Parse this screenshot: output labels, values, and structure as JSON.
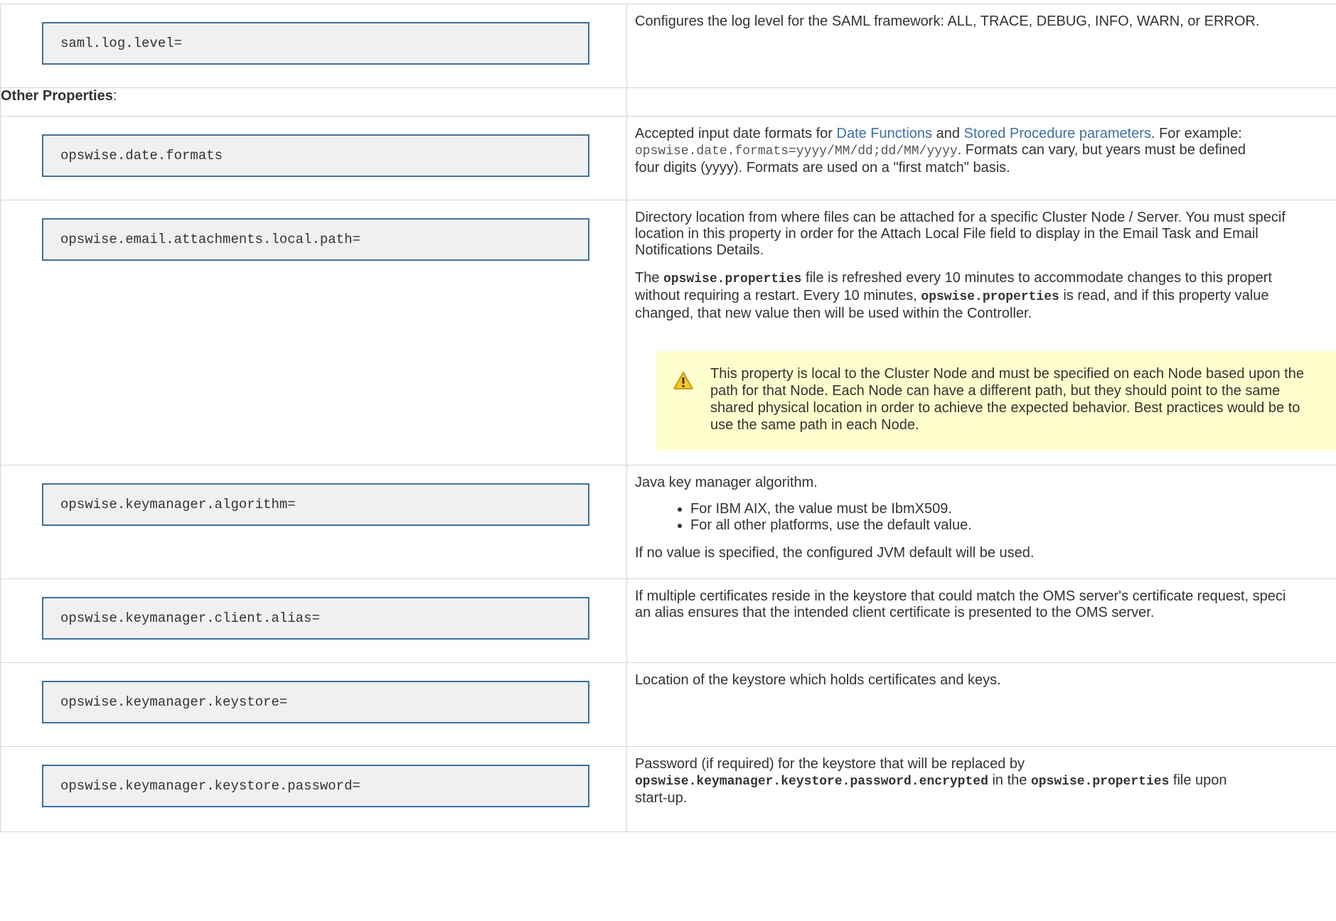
{
  "rows": {
    "saml_log_level": {
      "key": "saml.log.level=",
      "desc": "Configures the log level for the SAML framework: ALL, TRACE, DEBUG, INFO, WARN, or ERROR."
    },
    "section": {
      "label": "Other Properties",
      "suffix": ":"
    },
    "date_formats": {
      "key": "opswise.date.formats",
      "desc_pre": "Accepted input date formats for ",
      "link1": "Date Functions",
      "desc_and": " and ",
      "link2": "Stored Procedure parameters",
      "desc_example": ". For example:",
      "example_code": "opswise.date.formats=yyyy/MM/dd;dd/MM/yyyy",
      "desc_post_1": ". Formats can vary, but years must be defined",
      "desc_post_2": "four digits (yyyy). Formats are used on a \"first match\" basis."
    },
    "email_attachments": {
      "key": "opswise.email.attachments.local.path=",
      "p1_l1": "Directory location from where files can be attached for a specific Cluster Node / Server. You must specif",
      "p1_l2": "location in this property in order for the Attach Local File field to display in the Email Task and Email",
      "p1_l3": "Notifications Details.",
      "p2_l1_pre": "The ",
      "p2_l1_code": "opswise.properties",
      "p2_l1_post": " file is refreshed every 10 minutes to accommodate changes to this propert",
      "p2_l2_pre": "without requiring a restart. Every 10 minutes, ",
      "p2_l2_code": "opswise.properties",
      "p2_l2_post": " is read, and if this property value",
      "p2_l3": "changed, that new value then will be used within the Controller.",
      "warning": "This property is local to the Cluster Node and must be specified on each Node based upon the path for that Node. Each Node can have a different path, but they should point to the same shared physical location in order to achieve the expected behavior. Best practices would be to use the same path in each Node."
    },
    "keymanager_algorithm": {
      "key": "opswise.keymanager.algorithm=",
      "intro": "Java key manager algorithm.",
      "bullets": [
        "For IBM AIX, the value must be IbmX509.",
        "For all other platforms, use the default value."
      ],
      "footer": "If no value is specified, the configured JVM default will be used."
    },
    "keymanager_client_alias": {
      "key": "opswise.keymanager.client.alias=",
      "l1": "If multiple certificates reside in the keystore that could match the OMS server's certificate request, speci",
      "l2": "an alias ensures that the intended client certificate is presented to the OMS server."
    },
    "keymanager_keystore": {
      "key": "opswise.keymanager.keystore=",
      "desc": "Location of the keystore which holds certificates and keys."
    },
    "keymanager_keystore_password": {
      "key": "opswise.keymanager.keystore.password=",
      "l1": "Password (if required) for the keystore that will be replaced by",
      "l2_code1": "opswise.keymanager.keystore.password.encrypted",
      "l2_mid": " in the ",
      "l2_code2": "opswise.properties",
      "l2_post": " file upon",
      "l3": "start-up."
    }
  },
  "colors": {
    "link": "#3572b0",
    "code_border": "#3572b0",
    "warning_bg": "#ffffce",
    "warning_icon": "#f0c419"
  },
  "icons": {
    "warning": "warning-icon"
  }
}
